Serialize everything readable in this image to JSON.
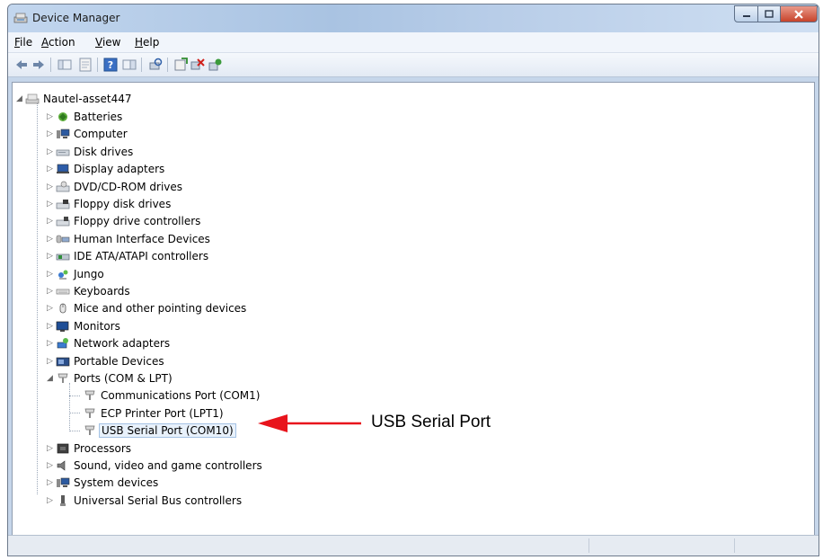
{
  "window": {
    "title": "Device Manager"
  },
  "menu": {
    "items": [
      {
        "label": "File",
        "key": "F",
        "rest": "ile"
      },
      {
        "label": "Action",
        "key": "A",
        "rest": "ction"
      },
      {
        "label": "View",
        "key": "V",
        "rest": "iew"
      },
      {
        "label": "Help",
        "key": "H",
        "rest": "elp"
      }
    ]
  },
  "tree": {
    "root": "Nautel-asset447",
    "categories": [
      {
        "label": "Batteries",
        "icon": "battery-icon"
      },
      {
        "label": "Computer",
        "icon": "computer-icon"
      },
      {
        "label": "Disk drives",
        "icon": "disk-drive-icon"
      },
      {
        "label": "Display adapters",
        "icon": "display-adapter-icon"
      },
      {
        "label": "DVD/CD-ROM drives",
        "icon": "dvd-drive-icon"
      },
      {
        "label": "Floppy disk drives",
        "icon": "floppy-disk-icon"
      },
      {
        "label": "Floppy drive controllers",
        "icon": "floppy-controller-icon"
      },
      {
        "label": "Human Interface Devices",
        "icon": "hid-icon"
      },
      {
        "label": "IDE ATA/ATAPI controllers",
        "icon": "ide-controller-icon"
      },
      {
        "label": "Jungo",
        "icon": "jungo-icon"
      },
      {
        "label": "Keyboards",
        "icon": "keyboard-icon"
      },
      {
        "label": "Mice and other pointing devices",
        "icon": "mouse-icon"
      },
      {
        "label": "Monitors",
        "icon": "monitor-icon"
      },
      {
        "label": "Network adapters",
        "icon": "network-adapter-icon"
      },
      {
        "label": "Portable Devices",
        "icon": "portable-device-icon"
      },
      {
        "label": "Ports (COM & LPT)",
        "icon": "port-icon"
      },
      {
        "label": "Processors",
        "icon": "processor-icon"
      },
      {
        "label": "Sound, video and game controllers",
        "icon": "sound-icon"
      },
      {
        "label": "System devices",
        "icon": "system-device-icon"
      },
      {
        "label": "Universal Serial Bus controllers",
        "icon": "usb-icon"
      }
    ],
    "ports_children": [
      {
        "label": "Communications Port (COM1)",
        "icon": "port-icon"
      },
      {
        "label": "ECP Printer Port (LPT1)",
        "icon": "port-icon"
      },
      {
        "label": "USB Serial Port (COM10)",
        "icon": "port-icon",
        "selected": true
      }
    ]
  },
  "annotation": {
    "text": "USB Serial Port",
    "arrow_color": "#e8141c"
  }
}
